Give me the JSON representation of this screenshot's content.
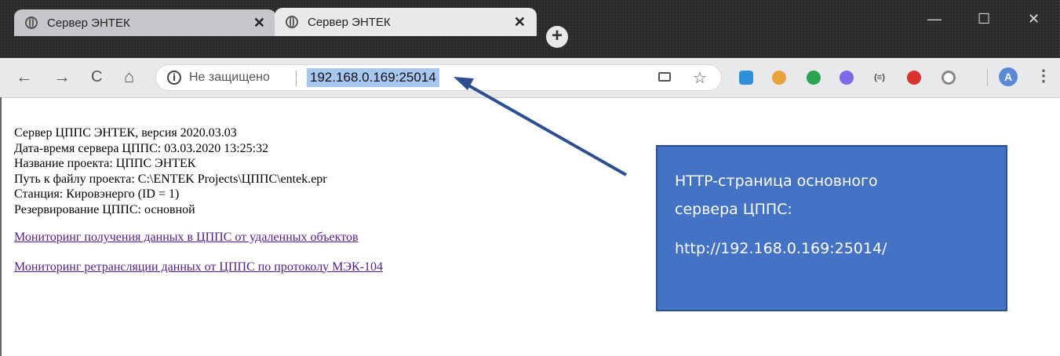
{
  "browser": {
    "tabs": [
      {
        "title": "Сервер ЭНТЕК",
        "close": "✕"
      },
      {
        "title": "Сервер ЭНТЕК",
        "close": "✕"
      }
    ],
    "new_tab": "+",
    "window_controls": {
      "minimize": "—",
      "maximize": "☐",
      "close": "✕"
    },
    "nav": {
      "back": "←",
      "forward": "→",
      "reload": "C",
      "home": "⌂"
    },
    "address_bar": {
      "security_label": "Не защищено",
      "url": "192.168.0.169:25014"
    },
    "profile_initial": "A",
    "menu": "⋮",
    "extensions": [
      "cast-icon",
      "star-icon",
      "extension-blue-icon",
      "extension-bowl-icon",
      "evernote-icon",
      "extension-check-icon",
      "extension-brackets-icon",
      "adblock-icon",
      "extension-circle-icon"
    ]
  },
  "page": {
    "lines": [
      "Сервер ЦППС ЭНТЕК, версия 2020.03.03",
      "Дата-время сервера ЦППС: 03.03.2020 13:25:32",
      "Название проекта: ЦППС ЭНТЕК",
      "Путь к файлу проекта: C:\\ENTEK Projects\\ЦППС\\entek.epr",
      "Станция: Кировэнерго (ID = 1)",
      "Резервирование ЦППС: основной"
    ],
    "links": [
      "Мониторинг получения данных в ЦППС от удаленных объектов",
      "Мониторинг ретрансляции данных от ЦППС по протоколу МЭК-104"
    ]
  },
  "callout": {
    "line1": "HTTP-страница основного",
    "line2": "сервера ЦППС:",
    "url": "http://192.168.0.169:25014/",
    "bg_color": "#4472c4"
  }
}
